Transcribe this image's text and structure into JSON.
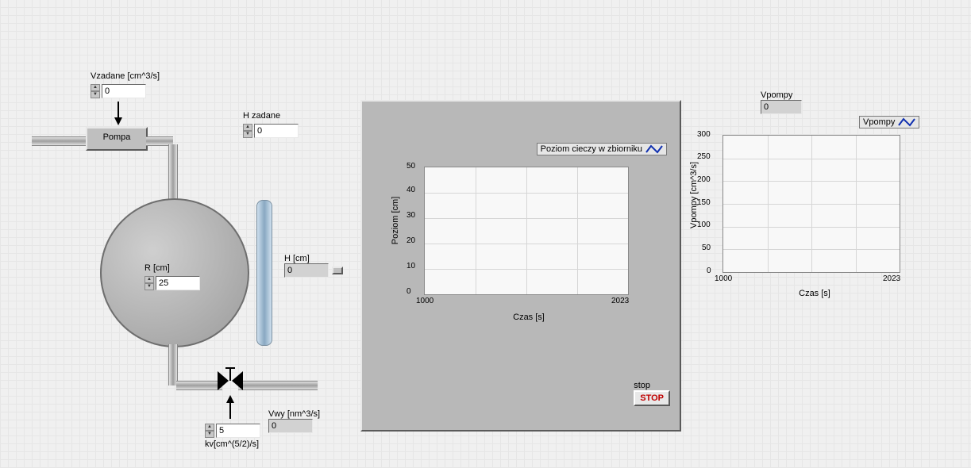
{
  "controls": {
    "vzadane": {
      "label": "Vzadane [cm^3/s]",
      "value": "0"
    },
    "hzadane": {
      "label": "H zadane",
      "value": "0"
    },
    "r": {
      "label": "R [cm]",
      "value": "25"
    },
    "kv": {
      "label": "kv[cm^(5/2)/s]",
      "value": "5"
    }
  },
  "indicators": {
    "h": {
      "label": "H [cm]",
      "value": "0"
    },
    "vwy": {
      "label": "Vwy [nm^3/s]",
      "value": "0"
    },
    "vpompy_out": {
      "label": "Vpompy",
      "value": "0"
    }
  },
  "pump_label": "Pompa",
  "stop": {
    "caption": "stop",
    "button": "STOP"
  },
  "chart_data": [
    {
      "type": "line",
      "title": "",
      "legend": "Poziom cieczy w zbiorniku",
      "xlabel": "Czas [s]",
      "ylabel": "Poziom [cm]",
      "x_range": [
        1000,
        2023
      ],
      "y_range": [
        0,
        50
      ],
      "y_ticks": [
        0,
        10,
        20,
        30,
        40,
        50
      ],
      "x_ticks": [
        1000,
        2023
      ],
      "series": [
        {
          "name": "Poziom cieczy w zbiorniku",
          "x": [],
          "y": []
        }
      ]
    },
    {
      "type": "line",
      "title": "",
      "legend": "Vpompy",
      "xlabel": "Czas [s]",
      "ylabel": "Vpompy [cm^3/s]",
      "x_range": [
        1000,
        2023
      ],
      "y_range": [
        0,
        300
      ],
      "y_ticks": [
        0,
        50,
        100,
        150,
        200,
        250,
        300
      ],
      "x_ticks": [
        1000,
        2023
      ],
      "series": [
        {
          "name": "Vpompy",
          "x": [],
          "y": []
        }
      ]
    }
  ]
}
